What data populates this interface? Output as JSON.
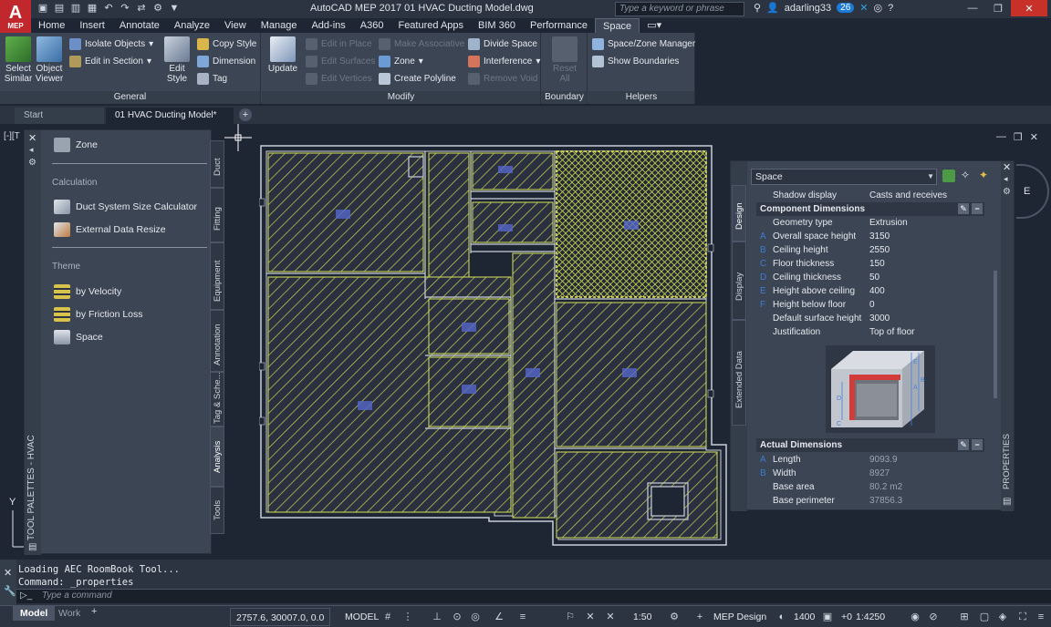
{
  "titlebar": {
    "app_letter": "A",
    "app_sub": "MEP",
    "title": "AutoCAD MEP 2017    01 HVAC Ducting Model.dwg",
    "search_placeholder": "Type a keyword or phrase",
    "username": "adarling33",
    "notif_count": "26"
  },
  "ribbon": {
    "tabs": [
      "Home",
      "Insert",
      "Annotate",
      "Analyze",
      "View",
      "Manage",
      "Add-ins",
      "A360",
      "Featured Apps",
      "BIM 360",
      "Performance",
      "Space"
    ],
    "active_tab": "Space",
    "panels": {
      "general": {
        "title": "General",
        "select_similar": "Select\nSimilar",
        "object_viewer": "Object\nViewer",
        "isolate_objects": "Isolate Objects",
        "edit_in_section": "Edit in Section",
        "edit_style": "Edit\nStyle",
        "copy_style": "Copy Style",
        "dimension": "Dimension",
        "tag": "Tag"
      },
      "modify": {
        "title": "Modify",
        "update": "Update",
        "edit_in_place": "Edit in Place",
        "edit_surfaces": "Edit Surfaces",
        "edit_vertices": "Edit Vertices",
        "make_associative": "Make Associative",
        "zone": "Zone",
        "create_polyline": "Create Polyline",
        "divide_space": "Divide Space",
        "interference": "Interference",
        "remove_void": "Remove Void"
      },
      "boundary": {
        "title": "Boundary",
        "reset_all": "Reset All"
      },
      "helpers": {
        "title": "Helpers",
        "space_zone_manager": "Space/Zone Manager",
        "show_boundaries": "Show Boundaries"
      }
    }
  },
  "doc_tabs": {
    "start": "Start",
    "active": "01 HVAC Ducting Model*"
  },
  "viewport_label": "[-][T",
  "tool_palette": {
    "title": "TOOL PALETTES - HVAC",
    "zone": "Zone",
    "calculation_heading": "Calculation",
    "duct_calc": "Duct System Size Calculator",
    "ext_resize": "External Data Resize",
    "theme_heading": "Theme",
    "by_velocity": "by Velocity",
    "by_friction": "by Friction Loss",
    "space": "Space",
    "vtabs": [
      "Duct",
      "Fitting",
      "Equipment",
      "Annotation",
      "Tag & Sche...",
      "Analysis",
      "Tools"
    ],
    "active_vtab": "Analysis"
  },
  "properties": {
    "title": "PROPERTIES",
    "selected": "Space",
    "vtabs": [
      "Design",
      "Display",
      "Extended Data"
    ],
    "shadow_display_key": "Shadow display",
    "shadow_display_val": "Casts and receives shadows",
    "component_dims_title": "Component Dimensions",
    "rows": [
      {
        "letter": "",
        "key": "Geometry type",
        "val": "Extrusion"
      },
      {
        "letter": "A",
        "key": "Overall space height",
        "val": "3150"
      },
      {
        "letter": "B",
        "key": "Ceiling height",
        "val": "2550"
      },
      {
        "letter": "C",
        "key": "Floor thickness",
        "val": "150"
      },
      {
        "letter": "D",
        "key": "Ceiling thickness",
        "val": "50"
      },
      {
        "letter": "E",
        "key": "Height above ceiling",
        "val": "400"
      },
      {
        "letter": "F",
        "key": "Height below floor",
        "val": "0"
      },
      {
        "letter": "",
        "key": "Default surface height",
        "val": "3000"
      },
      {
        "letter": "",
        "key": "Justification",
        "val": "Top of floor"
      }
    ],
    "actual_dims_title": "Actual Dimensions",
    "actual_rows": [
      {
        "letter": "A",
        "key": "Length",
        "val": "9093.9"
      },
      {
        "letter": "B",
        "key": "Width",
        "val": "8927"
      },
      {
        "letter": "",
        "key": "Base area",
        "val": "80.2 m2"
      },
      {
        "letter": "",
        "key": "Base perimeter",
        "val": "37856.3"
      }
    ]
  },
  "command_line": {
    "history_1": "Loading AEC RoomBook Tool...",
    "history_2": "Command: _properties",
    "placeholder": "Type a command"
  },
  "statusbar": {
    "model_tab": "Model",
    "work_tab": "Work",
    "coords": "2757.6, 30007.0, 0.0",
    "model": "MODEL",
    "scale": "1:50",
    "workspace": "MEP Design",
    "elevation": "1400",
    "offset": "+0",
    "scale2": "1:4250"
  },
  "colors": {
    "space_hatch": "#d6e25a",
    "selected_space": "#f2f05a",
    "tag_blue": "#6d7de0",
    "wall": "#c9cfd9"
  }
}
